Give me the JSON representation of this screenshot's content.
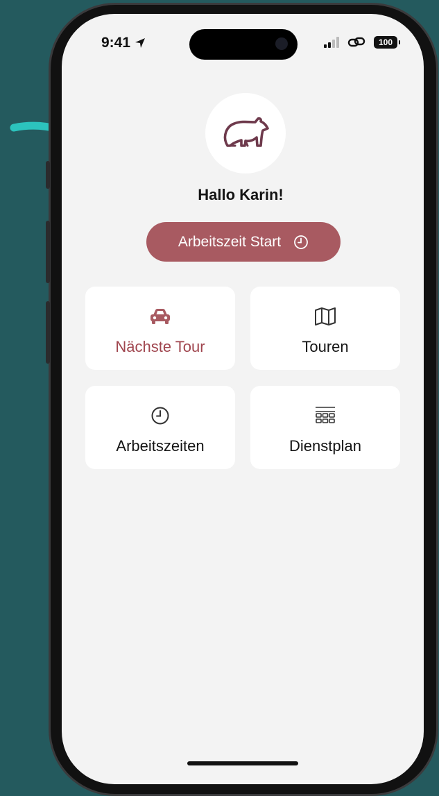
{
  "status_bar": {
    "time": "9:41",
    "battery_level": "100",
    "icons": [
      "location-arrow-icon",
      "signal-bars-icon",
      "link-icon",
      "battery-icon"
    ]
  },
  "home": {
    "avatar_icon": "bear-icon",
    "greeting": "Hallo Karin!",
    "start_button": {
      "label": "Arbeitszeit Start",
      "icon": "clock-icon"
    },
    "tiles": [
      {
        "label": "Nächste Tour",
        "icon": "car-icon",
        "accent": true
      },
      {
        "label": "Touren",
        "icon": "map-icon",
        "accent": false
      },
      {
        "label": "Arbeitszeiten",
        "icon": "clock-icon",
        "accent": false
      },
      {
        "label": "Dienstplan",
        "icon": "grid-calendar-icon",
        "accent": false
      }
    ]
  },
  "colors": {
    "background": "#245a5e",
    "arrow": "#2cc3bd",
    "accent": "#a85a61",
    "accent_text": "#a0464f",
    "screen": "#f3f3f3",
    "card": "#ffffff",
    "icon_brand": "#6e3a4c"
  }
}
